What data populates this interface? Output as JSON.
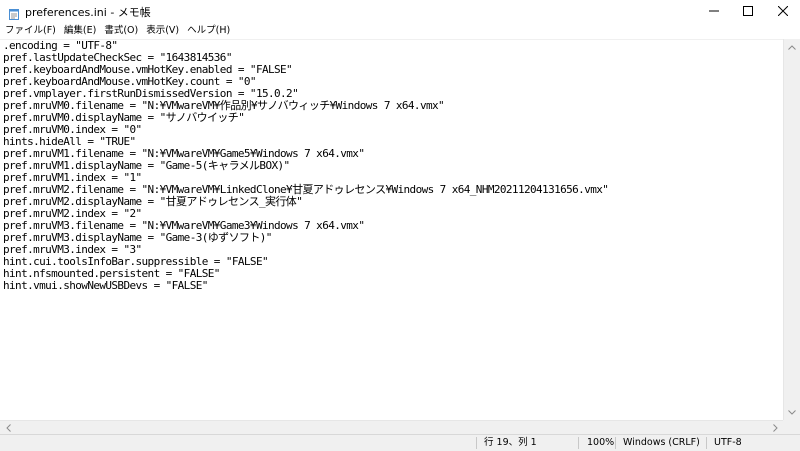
{
  "window": {
    "title": "preferences.ini - メモ帳"
  },
  "menu": [
    "ファイル(F)",
    "編集(E)",
    "書式(O)",
    "表示(V)",
    "ヘルプ(H)"
  ],
  "editor": {
    "lines": [
      ".encoding = \"UTF-8\"",
      "pref.lastUpdateCheckSec = \"1643814536\"",
      "pref.keyboardAndMouse.vmHotKey.enabled = \"FALSE\"",
      "pref.keyboardAndMouse.vmHotKey.count = \"0\"",
      "pref.vmplayer.firstRunDismissedVersion = \"15.0.2\"",
      "pref.mruVM0.filename = \"N:¥VMwareVM¥作品別¥サノバウィッチ¥Windows 7 x64.vmx\"",
      "pref.mruVM0.displayName = \"サノバウイッチ\"",
      "pref.mruVM0.index = \"0\"",
      "hints.hideAll = \"TRUE\"",
      "pref.mruVM1.filename = \"N:¥VMwareVM¥Game5¥Windows 7 x64.vmx\"",
      "pref.mruVM1.displayName = \"Game-5(キャラメルBOX)\"",
      "pref.mruVM1.index = \"1\"",
      "pref.mruVM2.filename = \"N:¥VMwareVM¥LinkedClone¥甘夏アドゥレセンス¥Windows 7 x64_NHM20211204131656.vmx\"",
      "pref.mruVM2.displayName = \"甘夏アドゥレセンス_実行体\"",
      "pref.mruVM2.index = \"2\"",
      "pref.mruVM3.filename = \"N:¥VMwareVM¥Game3¥Windows 7 x64.vmx\"",
      "pref.mruVM3.displayName = \"Game-3(ゆずソフト)\"",
      "pref.mruVM3.index = \"3\"",
      "hint.cui.toolsInfoBar.suppressible = \"FALSE\"",
      "hint.nfsmounted.persistent = \"FALSE\"",
      "hint.vmui.showNewUSBDevs = \"FALSE\""
    ]
  },
  "statusbar": {
    "position": "行 19、列 1",
    "zoom": "100%",
    "line_ending": "Windows (CRLF)",
    "encoding": "UTF-8"
  },
  "icons": {
    "app": "notepad-icon",
    "minimize": "minimize-icon",
    "maximize": "maximize-icon",
    "close": "close-icon"
  }
}
